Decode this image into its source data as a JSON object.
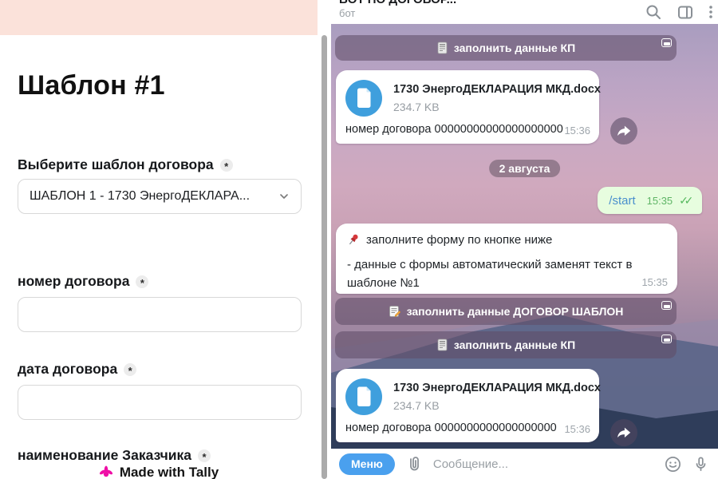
{
  "form": {
    "title": "Шаблон #1",
    "fields": [
      {
        "label": "Выберите шаблон договора",
        "required_mark": "*",
        "value": "ШАБЛОН 1 - 1730 ЭнергоДЕКЛАРА...",
        "type": "select"
      },
      {
        "label": "номер договора",
        "required_mark": "*",
        "value": "",
        "type": "text"
      },
      {
        "label": "дата договора",
        "required_mark": "*",
        "value": "",
        "type": "text"
      },
      {
        "label": "наименование Заказчика",
        "required_mark": "*",
        "type": "text"
      }
    ],
    "footer_badge": "Made with Tally",
    "banner_color": "#fbe2da"
  },
  "chat": {
    "header": {
      "title": "БОТ ПО ДОГОВОР...",
      "subtitle": "бот"
    },
    "inline_buttons": {
      "top_kp": "заполнить данные КП",
      "dogovor": "заполнить данные ДОГОВОР ШАБЛОН",
      "kp": "заполнить данные КП"
    },
    "doc_message_1": {
      "filename": "1730 ЭнергоДЕКЛАРАЦИЯ МКД.docx",
      "filesize": "234.7 KB",
      "caption": "номер договора 00000000000000000000",
      "time": "15:36"
    },
    "doc_message_2": {
      "filename": "1730 ЭнергоДЕКЛАРАЦИЯ МКД.docx",
      "filesize": "234.7 KB",
      "caption": "номер договора 0000000000000000000",
      "time": "15:36"
    },
    "date_separator": "2 августа",
    "outgoing_message": {
      "text": "/start",
      "time": "15:35",
      "read_checks": "✓✓"
    },
    "pinned_message": {
      "line1": "заполните форму по кнопке ниже",
      "line2": "- данные с формы автоматический заменят текст в шаблоне №1",
      "time": "15:35"
    },
    "composer": {
      "menu_button": "Меню",
      "placeholder": "Сообщение..."
    },
    "colors": {
      "doc_icon_blue": "#3f9fdd",
      "outgoing_bubble": "#e7fddf",
      "menu_button_blue": "#4aa0ee",
      "command_link_blue": "#4a8fcd",
      "time_green": "#5fb566"
    }
  }
}
